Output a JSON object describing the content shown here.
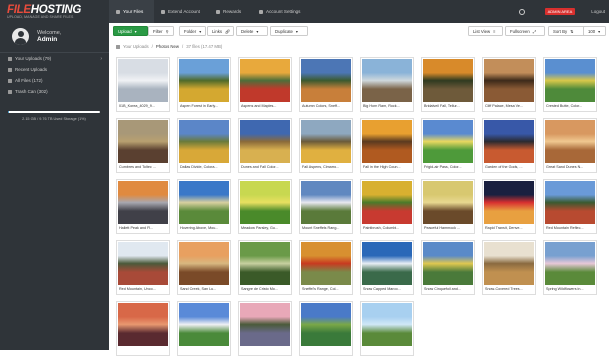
{
  "brand": {
    "logo_file": "FILE",
    "logo_hosting": "HOSTING",
    "tagline": "UPLOAD, MANAGE AND SHARE FILES"
  },
  "user": {
    "welcome": "Welcome,",
    "name": "Admin"
  },
  "sidebar": {
    "items": [
      {
        "label": "Your Uploads (79)",
        "has_chevron": true
      },
      {
        "label": "Recent Uploads"
      },
      {
        "label": "All Files (172)"
      },
      {
        "label": "Trash Can (302)"
      }
    ],
    "storage": {
      "text": "2.15 GB / 9.76 TB Used Storage (1%)",
      "percent": 1
    }
  },
  "topnav": {
    "tabs": [
      {
        "label": "Your Files",
        "active": true
      },
      {
        "label": "Extend Account"
      },
      {
        "label": "Rewards"
      },
      {
        "label": "Account Settings"
      }
    ],
    "admin_badge": "ADMIN AREA",
    "logout": "Logout"
  },
  "toolbar": {
    "upload": "Upload",
    "filter": "Filter",
    "folder": "Folder",
    "links": "Links",
    "delete": "Delete",
    "duplicate": "Duplicate",
    "list_view": "List View",
    "fullscreen": "Fullscreen",
    "sort_by": "Sort By",
    "per_page": "100"
  },
  "breadcrumb": {
    "root": "Your Uploads",
    "sep": "/",
    "current": "Photos New",
    "count": "37 files (17.47 MB)"
  },
  "colors": {
    "sidebar_bg": "#2f3439",
    "green": "#2a9a45",
    "admin_red": "#d9302e",
    "storage_blue": "#3aa0d8"
  },
  "files": [
    {
      "name": "01B_Korea_4029_9...",
      "colors": [
        "#d8dde4",
        "#a9b3bf",
        "#f0f2f5"
      ]
    },
    {
      "name": "Aspen Forest in Early...",
      "colors": [
        "#6aa0d8",
        "#d4a830",
        "#4f6a2a"
      ]
    },
    {
      "name": "Aspens and Maples...",
      "colors": [
        "#e8a93c",
        "#c0392b",
        "#4d6e3a"
      ]
    },
    {
      "name": "Autumn Colors, Sneff...",
      "colors": [
        "#4c76b5",
        "#c87f3a",
        "#3b5a2f"
      ]
    },
    {
      "name": "Big Horn Ram, Rock...",
      "colors": [
        "#8ab3d8",
        "#7a6348",
        "#cfd8dc"
      ]
    },
    {
      "name": "Bridalveil Fall, Tellur...",
      "colors": [
        "#d88a2a",
        "#6e5a3a",
        "#2f3a20"
      ]
    },
    {
      "name": "Cliff Palace, Mesa Ve...",
      "colors": [
        "#c28e5a",
        "#8a5a35",
        "#3d2a1a"
      ]
    },
    {
      "name": "Crested Butte, Color...",
      "colors": [
        "#5a8fd0",
        "#4e8a3a",
        "#d8c84a"
      ]
    },
    {
      "name": "Cumbres and Toltec ...",
      "colors": [
        "#a89878",
        "#5a4030",
        "#b8a070"
      ]
    },
    {
      "name": "Dallas Divide, Colora...",
      "colors": [
        "#5b86c8",
        "#d8a838",
        "#6a7a3a"
      ]
    },
    {
      "name": "Dunes and Fall Color...",
      "colors": [
        "#3f68b0",
        "#d8b050",
        "#8a6a3a"
      ]
    },
    {
      "name": "Fall Aspens, Cimarro...",
      "colors": [
        "#8ea8c0",
        "#e0b040",
        "#6a5a3a"
      ]
    },
    {
      "name": "Fall in the High Coun...",
      "colors": [
        "#e8a030",
        "#b05a20",
        "#5a3a20"
      ]
    },
    {
      "name": "Frigid-air Pass, Color...",
      "colors": [
        "#5a8ad0",
        "#4e9a3a",
        "#e8d860"
      ]
    },
    {
      "name": "Garden of the Gods, ...",
      "colors": [
        "#3858a8",
        "#c85a30",
        "#2a2a30"
      ]
    },
    {
      "name": "Great Sand Dunes N...",
      "colors": [
        "#d89860",
        "#a86838",
        "#f0c890"
      ]
    },
    {
      "name": "Hallett Peak and Fl...",
      "colors": [
        "#e08a40",
        "#404048",
        "#a8a8b0"
      ]
    },
    {
      "name": "Hovering Above, Mou...",
      "colors": [
        "#3a78c8",
        "#5a8a3a",
        "#d8d0a0"
      ]
    },
    {
      "name": "Meadow Parsley, Gu...",
      "colors": [
        "#c8d850",
        "#4a8a2a",
        "#e8e060"
      ]
    },
    {
      "name": "Mount Sneffels Rang...",
      "colors": [
        "#6088c0",
        "#5a7a3a",
        "#e8e8f0"
      ]
    },
    {
      "name": "Paintbrush, Columbi...",
      "colors": [
        "#d8b030",
        "#c83a30",
        "#4a7a2a"
      ]
    },
    {
      "name": "Peaceful Hammock ...",
      "colors": [
        "#d8c870",
        "#6a4a2a",
        "#e8d890"
      ]
    },
    {
      "name": "Rapid Transit, Denve...",
      "colors": [
        "#1a2040",
        "#e8a040",
        "#d83030"
      ]
    },
    {
      "name": "Red Mountain Reflec...",
      "colors": [
        "#6a9ad8",
        "#b84a30",
        "#3a5a30"
      ]
    },
    {
      "name": "Red Mountain, Unco...",
      "colors": [
        "#e0e8f0",
        "#a84a38",
        "#4a5a3a"
      ]
    },
    {
      "name": "Sand Creek, San Lu...",
      "colors": [
        "#e8a060",
        "#7a4a28",
        "#d8b880"
      ]
    },
    {
      "name": "Sangre de Cristo Mo...",
      "colors": [
        "#6a9a48",
        "#3a5a28",
        "#c8d0a0"
      ]
    },
    {
      "name": "Sneffel's Range, Col...",
      "colors": [
        "#d89030",
        "#7a8a4a",
        "#c83a20"
      ]
    },
    {
      "name": "Snow Capped Maroo...",
      "colors": [
        "#2a68b8",
        "#3a6a4a",
        "#e8eef5"
      ]
    },
    {
      "name": "Snow Cinquefoil and...",
      "colors": [
        "#5a8ac8",
        "#4a7a3a",
        "#e0c850"
      ]
    },
    {
      "name": "Snow-Covered Trees...",
      "colors": [
        "#e8e0d0",
        "#c09050",
        "#8a6a40"
      ]
    },
    {
      "name": "Spring Wildflowers in...",
      "colors": [
        "#78a0d0",
        "#5a8a3a",
        "#e8c8d8"
      ]
    },
    {
      "name": "",
      "colors": [
        "#d86848",
        "#5a2a30",
        "#e89870"
      ]
    },
    {
      "name": "",
      "colors": [
        "#5a8ad8",
        "#4a8a3a",
        "#f0f0f5"
      ]
    },
    {
      "name": "",
      "colors": [
        "#e8a8b8",
        "#6a6a8a",
        "#4a5a3a"
      ]
    },
    {
      "name": "",
      "colors": [
        "#4a7ac8",
        "#3a7a3a",
        "#7aa848"
      ]
    },
    {
      "name": "",
      "colors": [
        "#a8d0f0",
        "#5a8a3a",
        "#d0e8f8"
      ]
    }
  ]
}
